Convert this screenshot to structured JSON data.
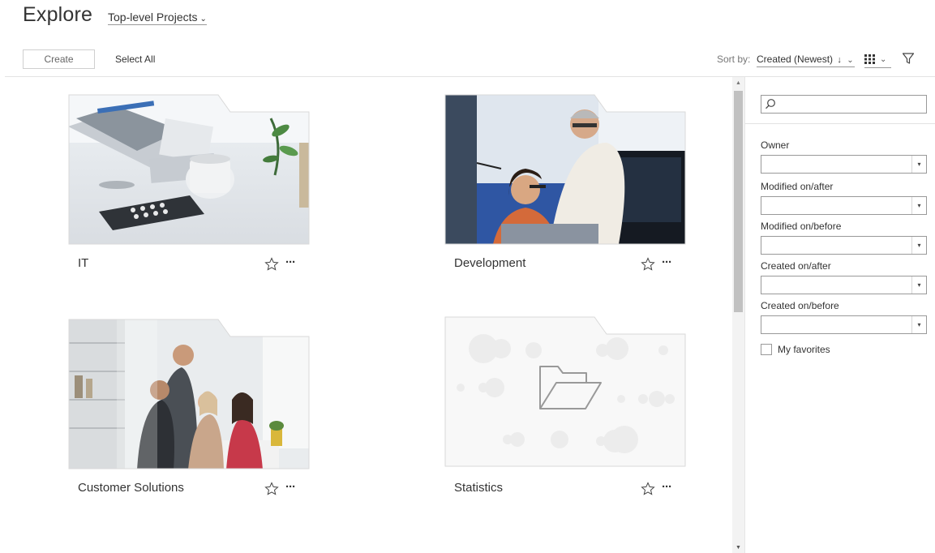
{
  "header": {
    "title": "Explore",
    "project_scope": "Top-level Projects",
    "project_scope_chevron": "⌄"
  },
  "toolbar": {
    "create_label": "Create",
    "select_all_label": "Select All",
    "sort_by_label": "Sort by:",
    "sort_value": "Created (Newest)",
    "sort_direction_icon": "↓",
    "chevron": "⌄",
    "view_mode_icon": "grid-icon",
    "filter_icon": "filter-icon"
  },
  "projects": [
    {
      "name": "IT",
      "thumbnail": "office-desk-photo",
      "favorite": false
    },
    {
      "name": "Development",
      "thumbnail": "developers-at-monitor-photo",
      "favorite": false
    },
    {
      "name": "Customer Solutions",
      "thumbnail": "team-meeting-photo",
      "favorite": false
    },
    {
      "name": "Statistics",
      "thumbnail": "default-folder-placeholder",
      "favorite": false
    }
  ],
  "card_actions": {
    "more_label": "···",
    "favorite_icon": "star-outline-icon"
  },
  "filter_panel": {
    "search_placeholder": "",
    "fields": [
      {
        "label": "Owner",
        "value": ""
      },
      {
        "label": "Modified on/after",
        "value": ""
      },
      {
        "label": "Modified on/before",
        "value": ""
      },
      {
        "label": "Created on/after",
        "value": ""
      },
      {
        "label": "Created on/before",
        "value": ""
      }
    ],
    "caret": "▾",
    "my_favorites_label": "My favorites",
    "my_favorites_checked": false
  },
  "scrollbar": {
    "up": "▲",
    "down": "▼"
  },
  "colors": {
    "text": "#333333",
    "border": "#999999",
    "divider": "#e3e3e3",
    "scroll_thumb": "#c1c1c1",
    "placeholder_folder": "#f4f4f4"
  }
}
